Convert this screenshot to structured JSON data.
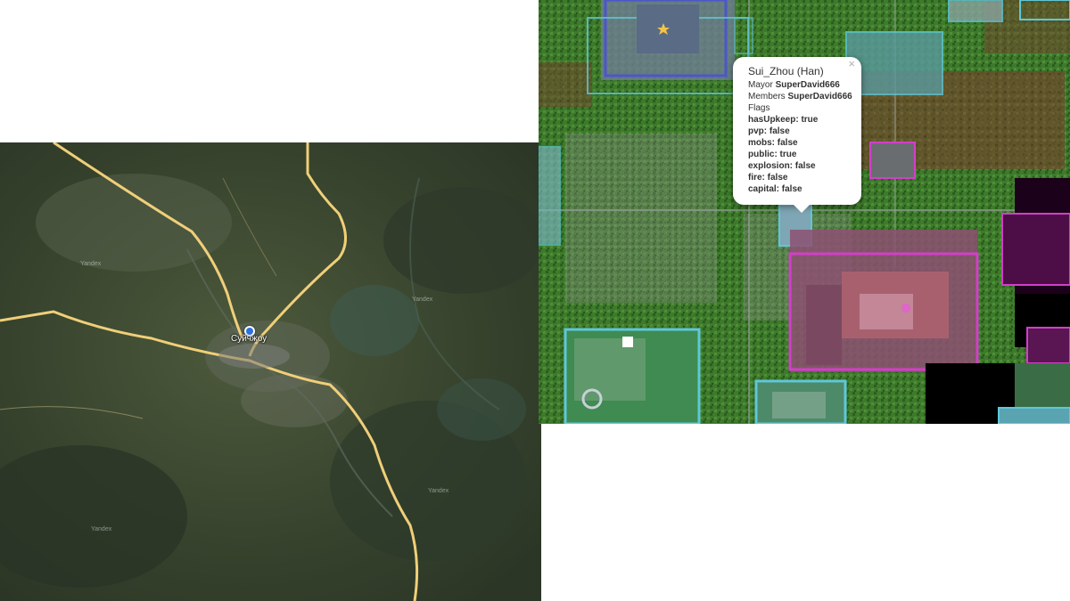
{
  "satellite_map": {
    "city_label": "Суйчжоу",
    "watermark": "Yandex",
    "colors": {
      "terrain": "#3a4530",
      "road": "#f0cf79"
    }
  },
  "minecraft_map": {
    "popup": {
      "title": "Sui_Zhou (Han)",
      "mayor_label": "Mayor",
      "mayor_value": "SuperDavid666",
      "members_label": "Members",
      "members_value": "SuperDavid666",
      "flags_label": "Flags",
      "flags": [
        "hasUpkeep: true",
        "pvp: false",
        "mobs: false",
        "public: true",
        "explosion: false",
        "fire: false",
        "capital: false"
      ],
      "close_glyph": "×"
    },
    "colors": {
      "claim_cyan": "#5fc7d8",
      "claim_magenta": "#d23fc9",
      "grass": "#3f7d2d"
    }
  }
}
